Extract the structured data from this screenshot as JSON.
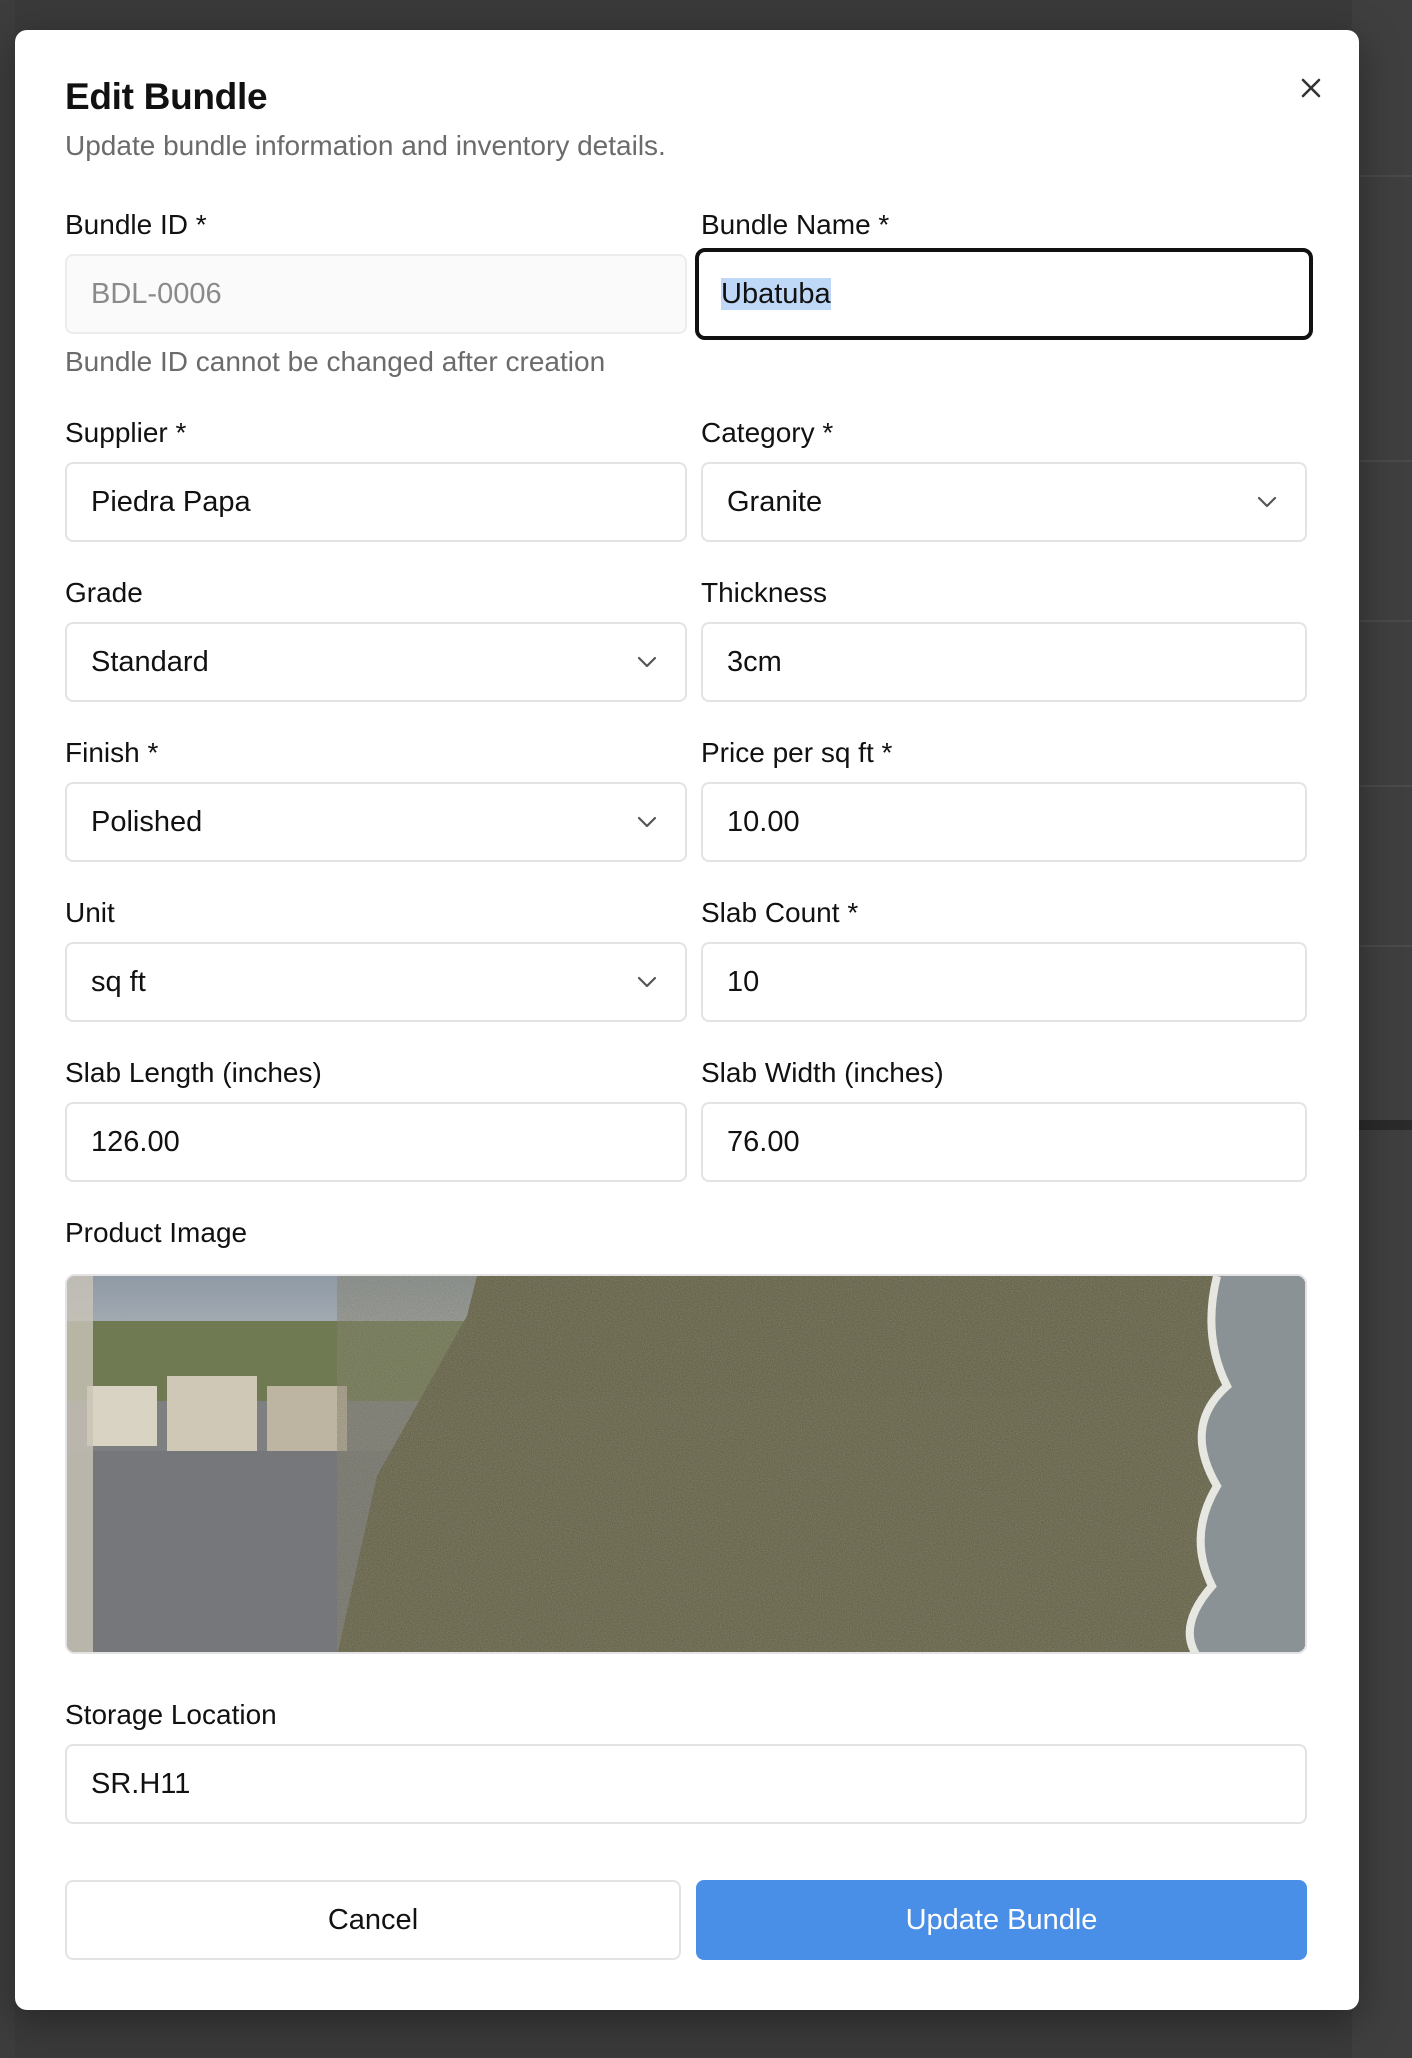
{
  "dialog": {
    "title": "Edit Bundle",
    "subtitle": "Update bundle information and inventory details."
  },
  "fields": {
    "bundle_id": {
      "label": "Bundle ID *",
      "value": "BDL-0006",
      "hint": "Bundle ID cannot be changed after creation"
    },
    "bundle_name": {
      "label": "Bundle Name *",
      "value": "Ubatuba"
    },
    "supplier": {
      "label": "Supplier *",
      "value": "Piedra Papa"
    },
    "category": {
      "label": "Category *",
      "value": "Granite"
    },
    "grade": {
      "label": "Grade",
      "value": "Standard"
    },
    "thickness": {
      "label": "Thickness",
      "value": "3cm"
    },
    "finish": {
      "label": "Finish *",
      "value": "Polished"
    },
    "price": {
      "label": "Price per sq ft *",
      "value": "10.00"
    },
    "unit": {
      "label": "Unit",
      "value": "sq ft"
    },
    "slab_count": {
      "label": "Slab Count *",
      "value": "10"
    },
    "slab_length": {
      "label": "Slab Length (inches)",
      "value": "126.00"
    },
    "slab_width": {
      "label": "Slab Width (inches)",
      "value": "76.00"
    },
    "storage": {
      "label": "Storage Location",
      "value": "SR.H11"
    }
  },
  "product_image": {
    "label": "Product Image"
  },
  "buttons": {
    "cancel": "Cancel",
    "update": "Update Bundle"
  },
  "colors": {
    "primary": "#4a8fe7",
    "overlay": "#3a3a3a",
    "selection": "#bfd8f7"
  },
  "icons": {
    "close": "close-icon",
    "dropdown": "chevron-down-icon"
  }
}
